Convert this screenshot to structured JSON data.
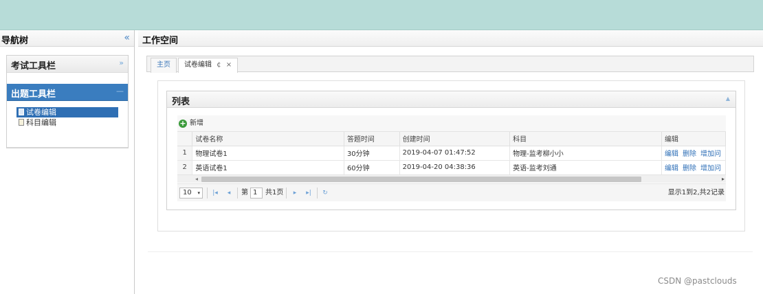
{
  "nav": {
    "title": "导航树",
    "collapse_icon": "«",
    "sections": [
      {
        "label": "考试工具栏",
        "tool": "»"
      },
      {
        "label": "出题工具栏",
        "tool": "—"
      }
    ],
    "tree_items": [
      {
        "label": "试卷编辑",
        "icon": "file-icon"
      },
      {
        "label": "科目编辑",
        "icon": "file-icon"
      }
    ]
  },
  "workspace": {
    "title": "工作空间",
    "tabs": [
      {
        "label": "主页"
      },
      {
        "label": "试卷编辑",
        "refresh": "¢",
        "close": "×"
      }
    ]
  },
  "list": {
    "title": "列表",
    "collapse_icon": "▲",
    "add_label": "新增",
    "add_icon": "+",
    "columns": [
      "",
      "试卷名称",
      "答题时间",
      "创建时间",
      "科目",
      "编辑"
    ],
    "rows": [
      {
        "no": "1",
        "name": "物理试卷1",
        "duration": "30分钟",
        "created": "2019-04-07 01:47:52",
        "subject": "物理-监考柳小小",
        "ops": [
          "编辑",
          "删除",
          "增加问"
        ]
      },
      {
        "no": "2",
        "name": "英语试卷1",
        "duration": "60分钟",
        "created": "2019-04-20 04:38:36",
        "subject": "英语-监考刘通",
        "ops": [
          "编辑",
          "删除",
          "增加问"
        ]
      }
    ],
    "scroll_left": "◂",
    "scroll_right": "▸"
  },
  "pager": {
    "page_size": "10",
    "dropdown": "▾",
    "first": "|◂",
    "prev": "◂",
    "next": "▸",
    "last": "▸|",
    "refresh": "↻",
    "page_label_pre": "第",
    "page_value": "1",
    "page_label_post": "共1页",
    "info": "显示1到2,共2记录"
  },
  "watermark": "CSDN @pastclouds",
  "colors": {
    "topbar": "#b7dcd8",
    "accent": "#3a7dbf",
    "link": "#2e6fb7"
  }
}
